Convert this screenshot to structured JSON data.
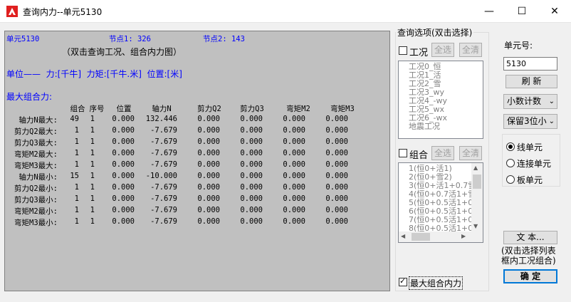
{
  "window": {
    "title": "查询内力--单元5130",
    "minimize": "—",
    "maximize": "☐",
    "close": "✕"
  },
  "results": {
    "element_label": "单元5130",
    "node1_label": "节点1: 326",
    "node2_label": "节点2: 143",
    "hint": "（双击查询工况、组合内力图）",
    "units": "单位——  力:[千牛]  力矩:[千牛.米]  位置:[米]",
    "section_title": "最大组合力:",
    "columns": [
      "组合",
      "序号",
      "位置",
      "轴力N",
      "剪力Q2",
      "剪力Q3",
      "弯矩M2",
      "弯矩M3"
    ],
    "rows": [
      {
        "label": "轴力N最大:",
        "vals": [
          "49",
          "1",
          "0.000",
          "132.446",
          "0.000",
          "0.000",
          "0.000",
          "0.000"
        ]
      },
      {
        "label": "剪力Q2最大:",
        "vals": [
          "1",
          "1",
          "0.000",
          "-7.679",
          "0.000",
          "0.000",
          "0.000",
          "0.000"
        ]
      },
      {
        "label": "剪力Q3最大:",
        "vals": [
          "1",
          "1",
          "0.000",
          "-7.679",
          "0.000",
          "0.000",
          "0.000",
          "0.000"
        ]
      },
      {
        "label": "弯矩M2最大:",
        "vals": [
          "1",
          "1",
          "0.000",
          "-7.679",
          "0.000",
          "0.000",
          "0.000",
          "0.000"
        ]
      },
      {
        "label": "弯矩M3最大:",
        "vals": [
          "1",
          "1",
          "0.000",
          "-7.679",
          "0.000",
          "0.000",
          "0.000",
          "0.000"
        ]
      },
      {
        "label": "轴力N最小:",
        "vals": [
          "15",
          "1",
          "0.000",
          "-10.000",
          "0.000",
          "0.000",
          "0.000",
          "0.000"
        ]
      },
      {
        "label": "剪力Q2最小:",
        "vals": [
          "1",
          "1",
          "0.000",
          "-7.679",
          "0.000",
          "0.000",
          "0.000",
          "0.000"
        ]
      },
      {
        "label": "剪力Q3最小:",
        "vals": [
          "1",
          "1",
          "0.000",
          "-7.679",
          "0.000",
          "0.000",
          "0.000",
          "0.000"
        ]
      },
      {
        "label": "弯矩M2最小:",
        "vals": [
          "1",
          "1",
          "0.000",
          "-7.679",
          "0.000",
          "0.000",
          "0.000",
          "0.000"
        ]
      },
      {
        "label": "弯矩M3最小:",
        "vals": [
          "1",
          "1",
          "0.000",
          "-7.679",
          "0.000",
          "0.000",
          "0.000",
          "0.000"
        ]
      }
    ]
  },
  "options": {
    "legend": "查询选项(双击选择)",
    "case_label": "工况",
    "case_select_all": "全选",
    "case_clear_all": "全清",
    "cases": [
      "工况0_恒",
      "工况1_活",
      "工况2_雪",
      "工况3_wy",
      "工况4_-wy",
      "工况5_wx",
      "工况6_-wx",
      "地震工况"
    ],
    "combo_label": "组合",
    "combo_select_all": "全选",
    "combo_clear_all": "全清",
    "combos": [
      "1(恒0+活1)",
      "2(恒0+雪2)",
      "3(恒0+活1+0.7雪",
      "4(恒0+0.7活1+雪",
      "5(恒0+0.5活1+0.",
      "6(恒0+0.5活1+0.",
      "7(恒0+0.5活1+0",
      "8(恒0+0.5活1+0."
    ],
    "max_combo_label": "最大组合内力",
    "max_combo_checked": true
  },
  "side": {
    "element_no_label": "单元号:",
    "element_no_value": "5130",
    "refresh": "刷 新",
    "decimal_mode": "小数计数",
    "decimal_places": "保留3位小",
    "radio_options": [
      "线单元",
      "连接单元",
      "板单元"
    ],
    "radio_selected": 0,
    "text_button": "文 本...",
    "text_hint": "(双击选择列表框内工况组合)",
    "ok_button": "确 定"
  },
  "colors": {
    "panel_bg": "#c0c0c0",
    "header_blue": "#0000ff",
    "icon_red": "#e02020"
  }
}
